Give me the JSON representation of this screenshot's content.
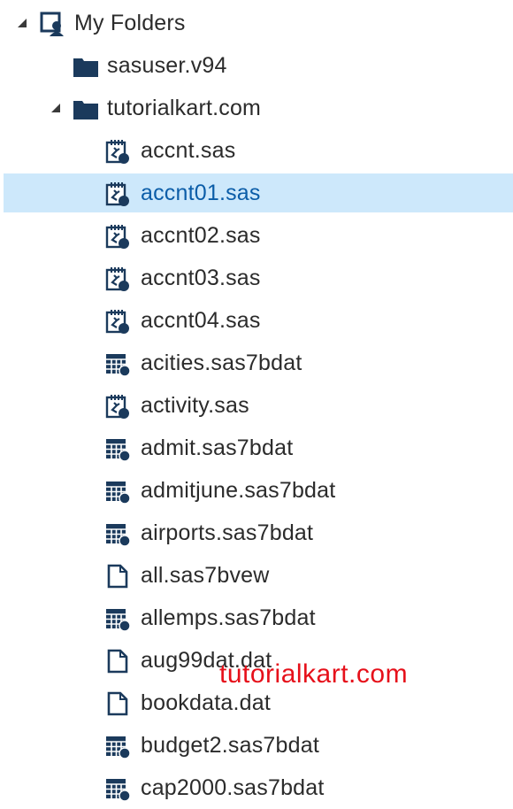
{
  "tree": {
    "root": {
      "label": "My Folders",
      "icon": "my-folders-icon",
      "expanded": true
    },
    "folders": [
      {
        "label": "sasuser.v94",
        "icon": "folder-icon",
        "expanded": false
      },
      {
        "label": "tutorialkart.com",
        "icon": "folder-icon",
        "expanded": true
      }
    ],
    "files": [
      {
        "label": "accnt.sas",
        "icon": "sas-program-icon",
        "selected": false
      },
      {
        "label": "accnt01.sas",
        "icon": "sas-program-icon",
        "selected": true
      },
      {
        "label": "accnt02.sas",
        "icon": "sas-program-icon",
        "selected": false
      },
      {
        "label": "accnt03.sas",
        "icon": "sas-program-icon",
        "selected": false
      },
      {
        "label": "accnt04.sas",
        "icon": "sas-program-icon",
        "selected": false
      },
      {
        "label": "acities.sas7bdat",
        "icon": "sas-dataset-icon",
        "selected": false
      },
      {
        "label": "activity.sas",
        "icon": "sas-program-icon",
        "selected": false
      },
      {
        "label": "admit.sas7bdat",
        "icon": "sas-dataset-icon",
        "selected": false
      },
      {
        "label": "admitjune.sas7bdat",
        "icon": "sas-dataset-icon",
        "selected": false
      },
      {
        "label": "airports.sas7bdat",
        "icon": "sas-dataset-icon",
        "selected": false
      },
      {
        "label": "all.sas7bvew",
        "icon": "file-icon",
        "selected": false
      },
      {
        "label": "allemps.sas7bdat",
        "icon": "sas-dataset-icon",
        "selected": false
      },
      {
        "label": "aug99dat.dat",
        "icon": "file-icon",
        "selected": false
      },
      {
        "label": "bookdata.dat",
        "icon": "file-icon",
        "selected": false
      },
      {
        "label": "budget2.sas7bdat",
        "icon": "sas-dataset-icon",
        "selected": false
      },
      {
        "label": "cap2000.sas7bdat",
        "icon": "sas-dataset-icon",
        "selected": false
      }
    ]
  },
  "watermark": "tutorialkart.com",
  "colors": {
    "icon": "#1b3a5c",
    "selection": "#cde8fb",
    "selected_text": "#0b5da8",
    "watermark": "#e6101a"
  }
}
